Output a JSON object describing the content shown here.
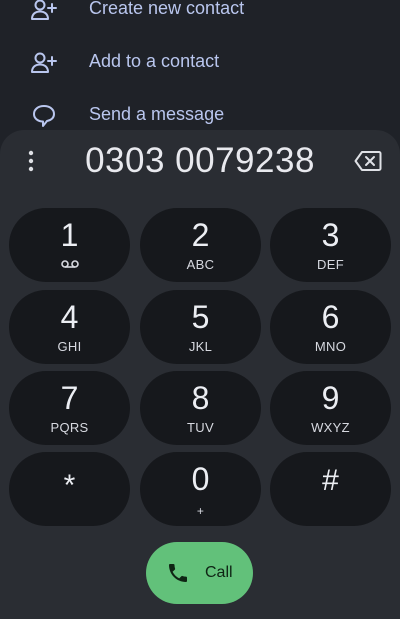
{
  "actions": [
    {
      "label": "Create new contact",
      "icon": "person-add-icon"
    },
    {
      "label": "Add to a contact",
      "icon": "person-add-icon"
    },
    {
      "label": "Send a message",
      "icon": "message-bubble-icon"
    }
  ],
  "dialpad": {
    "number": "0303 0079238",
    "menu_icon": "more-vertical-icon",
    "backspace_icon": "backspace-icon"
  },
  "keys": [
    {
      "digit": "1",
      "letters": "",
      "icon": "voicemail-icon"
    },
    {
      "digit": "2",
      "letters": "ABC"
    },
    {
      "digit": "3",
      "letters": "DEF"
    },
    {
      "digit": "4",
      "letters": "GHI"
    },
    {
      "digit": "5",
      "letters": "JKL"
    },
    {
      "digit": "6",
      "letters": "MNO"
    },
    {
      "digit": "7",
      "letters": "PQRS"
    },
    {
      "digit": "8",
      "letters": "TUV"
    },
    {
      "digit": "9",
      "letters": "WXYZ"
    },
    {
      "digit": "*",
      "letters": ""
    },
    {
      "digit": "0",
      "letters": "+"
    },
    {
      "digit": "#",
      "letters": ""
    }
  ],
  "call": {
    "label": "Call",
    "icon": "phone-icon"
  },
  "colors": {
    "background": "#1f2228",
    "sheet": "#2a2d33",
    "key": "#16181c",
    "accent_text": "#b9c6ee",
    "call_button": "#62c17a"
  }
}
